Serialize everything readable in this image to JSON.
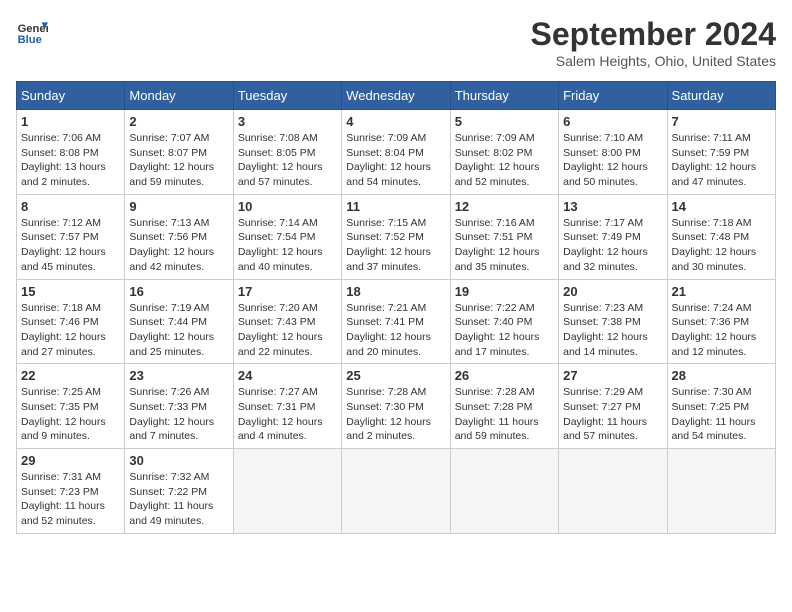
{
  "header": {
    "logo_line1": "General",
    "logo_line2": "Blue",
    "month": "September 2024",
    "location": "Salem Heights, Ohio, United States"
  },
  "days_of_week": [
    "Sunday",
    "Monday",
    "Tuesday",
    "Wednesday",
    "Thursday",
    "Friday",
    "Saturday"
  ],
  "weeks": [
    [
      {
        "num": "1",
        "info": "Sunrise: 7:06 AM\nSunset: 8:08 PM\nDaylight: 13 hours\nand 2 minutes."
      },
      {
        "num": "2",
        "info": "Sunrise: 7:07 AM\nSunset: 8:07 PM\nDaylight: 12 hours\nand 59 minutes."
      },
      {
        "num": "3",
        "info": "Sunrise: 7:08 AM\nSunset: 8:05 PM\nDaylight: 12 hours\nand 57 minutes."
      },
      {
        "num": "4",
        "info": "Sunrise: 7:09 AM\nSunset: 8:04 PM\nDaylight: 12 hours\nand 54 minutes."
      },
      {
        "num": "5",
        "info": "Sunrise: 7:09 AM\nSunset: 8:02 PM\nDaylight: 12 hours\nand 52 minutes."
      },
      {
        "num": "6",
        "info": "Sunrise: 7:10 AM\nSunset: 8:00 PM\nDaylight: 12 hours\nand 50 minutes."
      },
      {
        "num": "7",
        "info": "Sunrise: 7:11 AM\nSunset: 7:59 PM\nDaylight: 12 hours\nand 47 minutes."
      }
    ],
    [
      {
        "num": "8",
        "info": "Sunrise: 7:12 AM\nSunset: 7:57 PM\nDaylight: 12 hours\nand 45 minutes."
      },
      {
        "num": "9",
        "info": "Sunrise: 7:13 AM\nSunset: 7:56 PM\nDaylight: 12 hours\nand 42 minutes."
      },
      {
        "num": "10",
        "info": "Sunrise: 7:14 AM\nSunset: 7:54 PM\nDaylight: 12 hours\nand 40 minutes."
      },
      {
        "num": "11",
        "info": "Sunrise: 7:15 AM\nSunset: 7:52 PM\nDaylight: 12 hours\nand 37 minutes."
      },
      {
        "num": "12",
        "info": "Sunrise: 7:16 AM\nSunset: 7:51 PM\nDaylight: 12 hours\nand 35 minutes."
      },
      {
        "num": "13",
        "info": "Sunrise: 7:17 AM\nSunset: 7:49 PM\nDaylight: 12 hours\nand 32 minutes."
      },
      {
        "num": "14",
        "info": "Sunrise: 7:18 AM\nSunset: 7:48 PM\nDaylight: 12 hours\nand 30 minutes."
      }
    ],
    [
      {
        "num": "15",
        "info": "Sunrise: 7:18 AM\nSunset: 7:46 PM\nDaylight: 12 hours\nand 27 minutes."
      },
      {
        "num": "16",
        "info": "Sunrise: 7:19 AM\nSunset: 7:44 PM\nDaylight: 12 hours\nand 25 minutes."
      },
      {
        "num": "17",
        "info": "Sunrise: 7:20 AM\nSunset: 7:43 PM\nDaylight: 12 hours\nand 22 minutes."
      },
      {
        "num": "18",
        "info": "Sunrise: 7:21 AM\nSunset: 7:41 PM\nDaylight: 12 hours\nand 20 minutes."
      },
      {
        "num": "19",
        "info": "Sunrise: 7:22 AM\nSunset: 7:40 PM\nDaylight: 12 hours\nand 17 minutes."
      },
      {
        "num": "20",
        "info": "Sunrise: 7:23 AM\nSunset: 7:38 PM\nDaylight: 12 hours\nand 14 minutes."
      },
      {
        "num": "21",
        "info": "Sunrise: 7:24 AM\nSunset: 7:36 PM\nDaylight: 12 hours\nand 12 minutes."
      }
    ],
    [
      {
        "num": "22",
        "info": "Sunrise: 7:25 AM\nSunset: 7:35 PM\nDaylight: 12 hours\nand 9 minutes."
      },
      {
        "num": "23",
        "info": "Sunrise: 7:26 AM\nSunset: 7:33 PM\nDaylight: 12 hours\nand 7 minutes."
      },
      {
        "num": "24",
        "info": "Sunrise: 7:27 AM\nSunset: 7:31 PM\nDaylight: 12 hours\nand 4 minutes."
      },
      {
        "num": "25",
        "info": "Sunrise: 7:28 AM\nSunset: 7:30 PM\nDaylight: 12 hours\nand 2 minutes."
      },
      {
        "num": "26",
        "info": "Sunrise: 7:28 AM\nSunset: 7:28 PM\nDaylight: 11 hours\nand 59 minutes."
      },
      {
        "num": "27",
        "info": "Sunrise: 7:29 AM\nSunset: 7:27 PM\nDaylight: 11 hours\nand 57 minutes."
      },
      {
        "num": "28",
        "info": "Sunrise: 7:30 AM\nSunset: 7:25 PM\nDaylight: 11 hours\nand 54 minutes."
      }
    ],
    [
      {
        "num": "29",
        "info": "Sunrise: 7:31 AM\nSunset: 7:23 PM\nDaylight: 11 hours\nand 52 minutes."
      },
      {
        "num": "30",
        "info": "Sunrise: 7:32 AM\nSunset: 7:22 PM\nDaylight: 11 hours\nand 49 minutes."
      },
      {
        "num": "",
        "info": ""
      },
      {
        "num": "",
        "info": ""
      },
      {
        "num": "",
        "info": ""
      },
      {
        "num": "",
        "info": ""
      },
      {
        "num": "",
        "info": ""
      }
    ]
  ]
}
